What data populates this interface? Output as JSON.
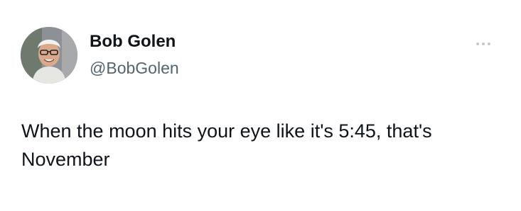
{
  "author": {
    "display_name": "Bob Golen",
    "handle": "@BobGolen",
    "avatar_icon": "profile-photo"
  },
  "tweet": {
    "text": "When the moon hits your eye like it's 5:45, that's November"
  },
  "menu": {
    "icon": "more-horizontal-icon"
  },
  "colors": {
    "text_primary": "#0f1419",
    "text_secondary": "#536471",
    "more_dots": "#c3c8cd",
    "background": "#ffffff"
  }
}
